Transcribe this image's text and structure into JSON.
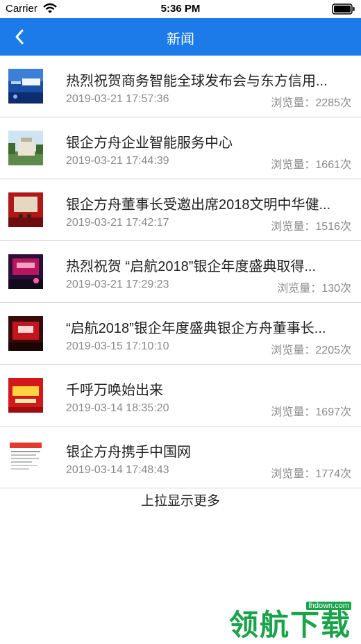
{
  "status_bar": {
    "carrier": "Carrier",
    "time": "5:36 PM"
  },
  "nav": {
    "title": "新闻"
  },
  "news": [
    {
      "title": "热烈祝贺商务智能全球发布会与东方信用...",
      "date": "2019-03-21 17:57:36",
      "views": "浏览量：2285次",
      "thumb": "conference-blue"
    },
    {
      "title": "银企方舟企业智能服务中心",
      "date": "2019-03-21 17:44:39",
      "views": "浏览量：1661次",
      "thumb": "building"
    },
    {
      "title": "银企方舟董事长受邀出席2018文明中华健...",
      "date": "2019-03-21 17:42:17",
      "views": "浏览量：1516次",
      "thumb": "stage-red"
    },
    {
      "title": "热烈祝贺 “启航2018”银企年度盛典取得...",
      "date": "2019-03-21 17:29:23",
      "views": "浏览量：130次",
      "thumb": "stage-purple"
    },
    {
      "title": "“启航2018”银企年度盛典银企方舟董事长...",
      "date": "2019-03-15 17:10:10",
      "views": "浏览量：2205次",
      "thumb": "stage-dark-red"
    },
    {
      "title": "千呼万唤始出来",
      "date": "2019-03-14 18:35:20",
      "views": "浏览量：1697次",
      "thumb": "poster-red"
    },
    {
      "title": "银企方舟携手中国网",
      "date": "2019-03-14 17:48:43",
      "views": "浏览量：1774次",
      "thumb": "webpage"
    }
  ],
  "load_more": "上拉显示更多",
  "watermark": {
    "text": "领航下载",
    "url": "lhdown.com"
  },
  "colors": {
    "nav_bg": "#1c7be8",
    "meta_text": "#8a8a8a",
    "divider": "#d6d6d6",
    "watermark": "#1aa34a"
  }
}
